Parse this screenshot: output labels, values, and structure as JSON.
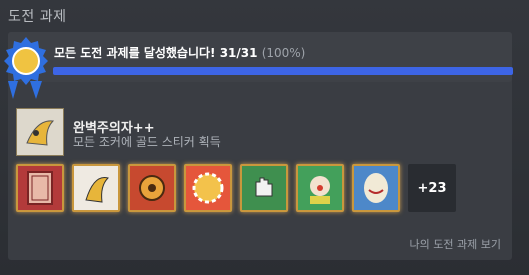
{
  "section": {
    "title": "도전 과제"
  },
  "progress": {
    "summary": "모든 도전 과제를 달성했습니다! 31/31",
    "percent_text": "(100%)",
    "fraction": 1.0,
    "bar_color": "#3d65e6"
  },
  "achievement": {
    "title": "완벽주의자++",
    "description": "모든 조커에 골드 스티커 획득",
    "icon": "jester-sticker-icon"
  },
  "thumbnails": [
    {
      "icon": "card-back-icon",
      "bg": "#b33a3a"
    },
    {
      "icon": "jester-icon",
      "bg": "#efeae2"
    },
    {
      "icon": "pumpkin-icon",
      "bg": "#c7492f"
    },
    {
      "icon": "sun-chip-icon",
      "bg": "#e5563b"
    },
    {
      "icon": "hand-icon",
      "bg": "#3f8f4f"
    },
    {
      "icon": "clown-icon",
      "bg": "#43a05b"
    },
    {
      "icon": "egg-face-icon",
      "bg": "#4d88c9"
    }
  ],
  "more_count": "+23",
  "view_link": "나의 도전 과제 보기",
  "colors": {
    "accent": "#3d65e6",
    "gold": "#c9973d"
  }
}
